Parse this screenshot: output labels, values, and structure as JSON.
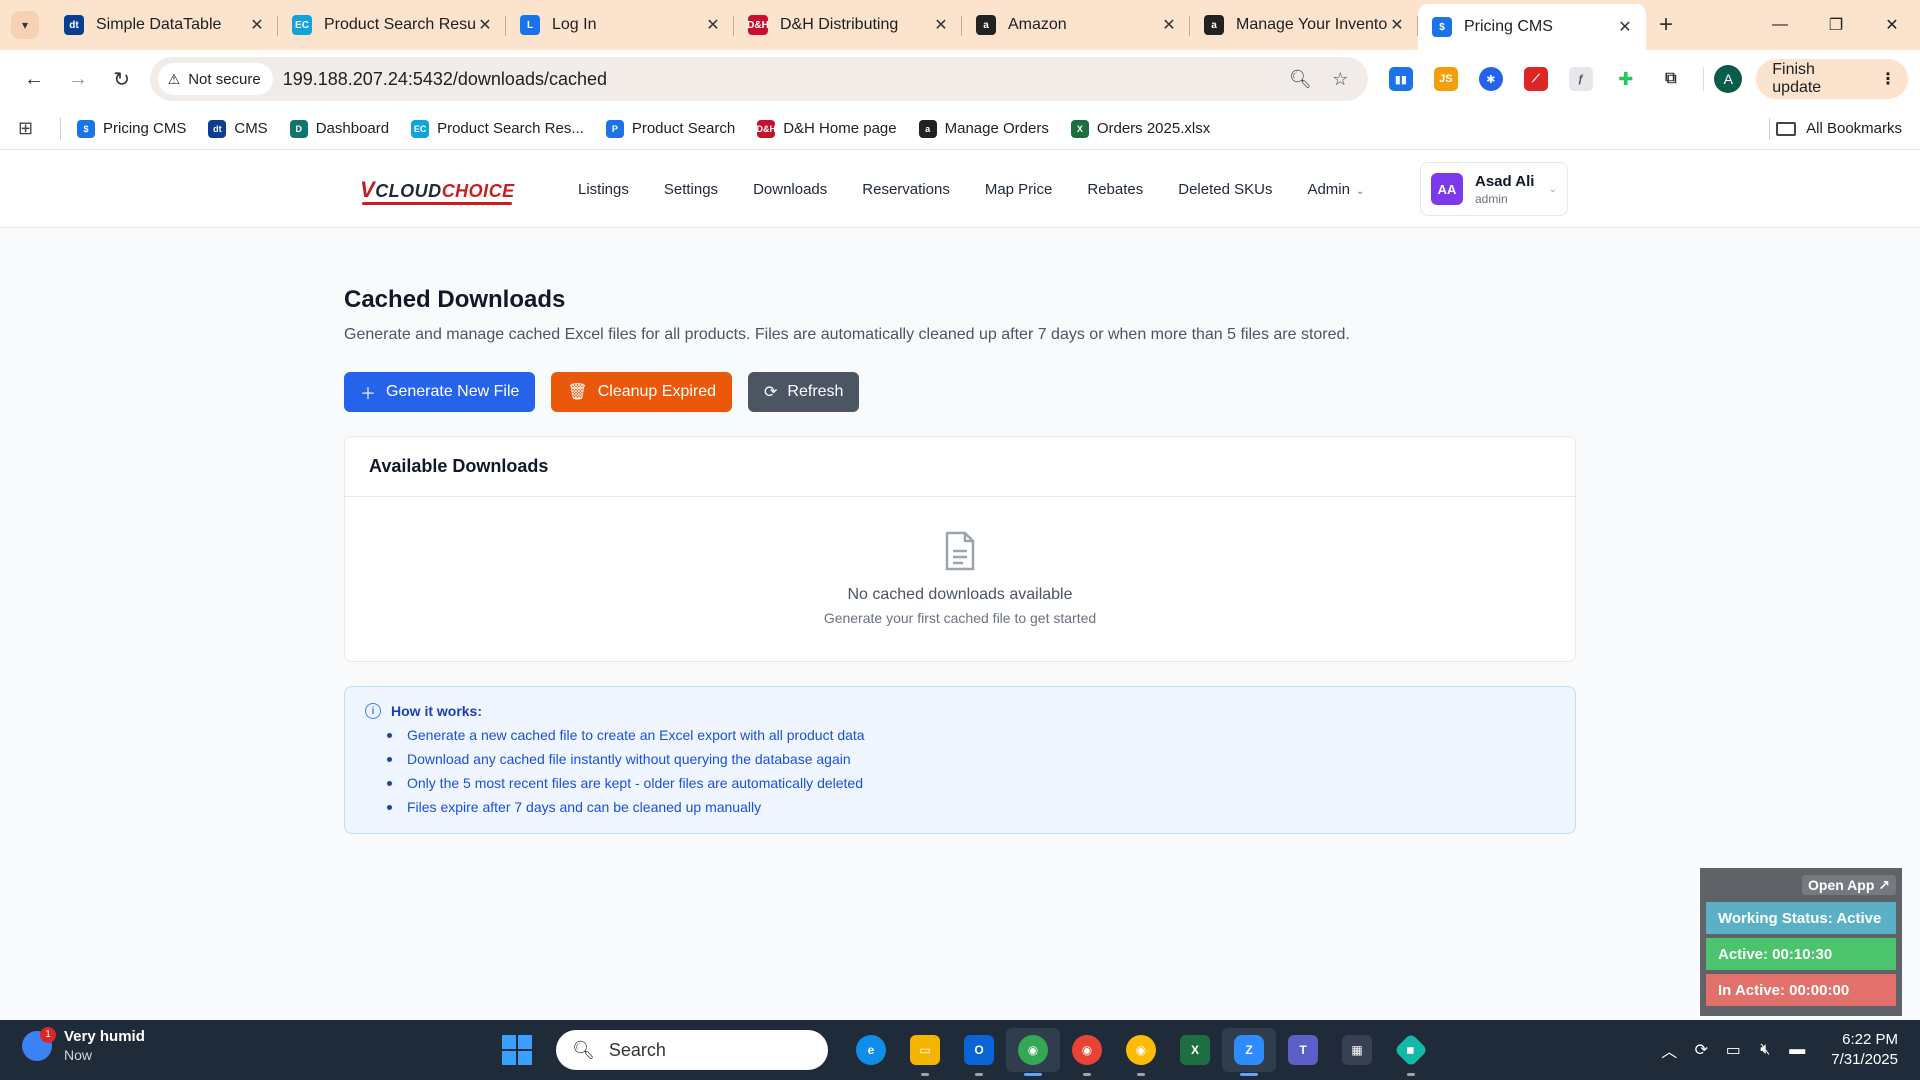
{
  "browser": {
    "tabs": [
      {
        "title": "Simple DataTable",
        "icon": "datatable-icon",
        "color": "#0b3d91",
        "glyph": "dt"
      },
      {
        "title": "Product Search Results",
        "icon": "ec-icon",
        "color": "#12a4d9",
        "glyph": "EC"
      },
      {
        "title": "Log In",
        "icon": "login-icon",
        "color": "#1a73e8",
        "glyph": "L"
      },
      {
        "title": "D&H Distributing",
        "icon": "dh-icon",
        "color": "#c8102e",
        "glyph": "D&H"
      },
      {
        "title": "Amazon",
        "icon": "amazon-icon",
        "color": "#222222",
        "glyph": "a"
      },
      {
        "title": "Manage Your Inventory",
        "icon": "amazon-icon",
        "color": "#222222",
        "glyph": "a"
      },
      {
        "title": "Pricing CMS",
        "icon": "dollar-icon",
        "color": "#1a73e8",
        "glyph": "$"
      }
    ],
    "url": "199.188.207.24:5432/downloads/cached",
    "not_secure": "Not secure",
    "finish_update": "Finish update",
    "profile_initial": "A",
    "bookmarks": [
      {
        "label": "Pricing CMS",
        "color": "#1a73e8",
        "glyph": "$"
      },
      {
        "label": "CMS",
        "color": "#0b3d91",
        "glyph": "dt"
      },
      {
        "label": "Dashboard",
        "color": "#0f766e",
        "glyph": "D"
      },
      {
        "label": "Product Search Res...",
        "color": "#12a4d9",
        "glyph": "EC"
      },
      {
        "label": "Product Search",
        "color": "#1a73e8",
        "glyph": "P"
      },
      {
        "label": "D&H Home page",
        "color": "#c8102e",
        "glyph": "D&H"
      },
      {
        "label": "Manage Orders",
        "color": "#222222",
        "glyph": "a"
      },
      {
        "label": "Orders 2025.xlsx",
        "color": "#1d6f42",
        "glyph": "X"
      }
    ],
    "all_bookmarks": "All Bookmarks"
  },
  "app": {
    "logo": {
      "v": "V",
      "cloud": "CLOUD",
      "choice": "CHOICE"
    },
    "nav": [
      "Listings",
      "Settings",
      "Downloads",
      "Reservations",
      "Map Price",
      "Rebates",
      "Deleted SKUs"
    ],
    "nav_admin": "Admin",
    "user": {
      "initials": "AA",
      "name": "Asad Ali",
      "role": "admin"
    }
  },
  "page": {
    "title": "Cached Downloads",
    "description": "Generate and manage cached Excel files for all products. Files are automatically cleaned up after 7 days or when more than 5 files are stored.",
    "buttons": {
      "generate": "Generate New File",
      "cleanup": "Cleanup Expired",
      "refresh": "Refresh"
    },
    "downloads_card": {
      "title": "Available Downloads",
      "empty_title": "No cached downloads available",
      "empty_subtitle": "Generate your first cached file to get started"
    },
    "info": {
      "title": "How it works:",
      "items": [
        "Generate a new cached file to create an Excel export with all product data",
        "Download any cached file instantly without querying the database again",
        "Only the 5 most recent files are kept - older files are automatically deleted",
        "Files expire after 7 days and can be cleaned up manually"
      ]
    }
  },
  "widget": {
    "open_app": "Open App ↗",
    "status": "Working Status: Active",
    "active": "Active: 00:10:30",
    "inactive": "In Active: 00:00:00"
  },
  "taskbar": {
    "weather_title": "Very humid",
    "weather_sub": "Now",
    "weather_badge": "1",
    "search": "Search",
    "time": "6:22 PM",
    "date": "7/31/2025"
  }
}
